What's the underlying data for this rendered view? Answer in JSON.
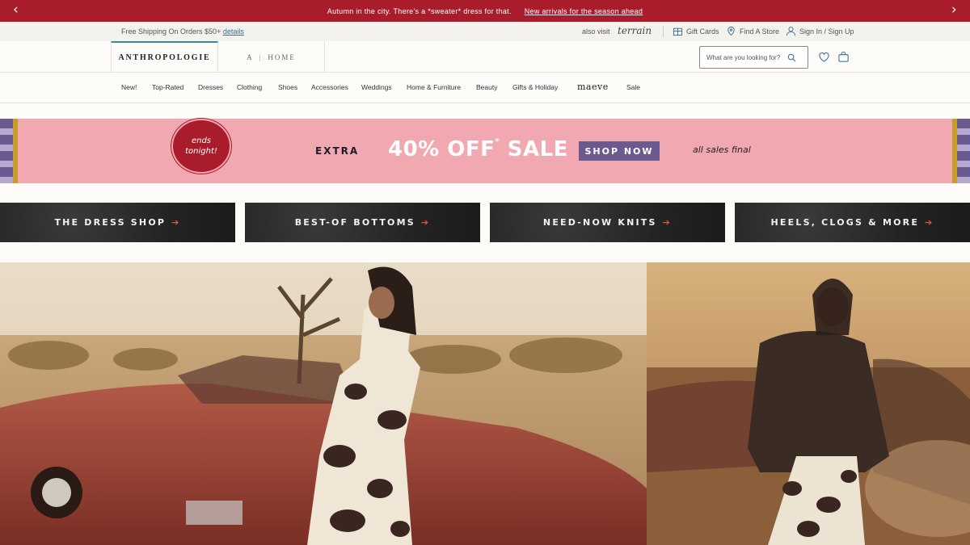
{
  "promo": {
    "message": "Autumn in the city. There's a *sweater* dress for that.",
    "link": "New arrivals for the season ahead",
    "prev_icon": "chevron-left-icon",
    "next_icon": "chevron-right-icon",
    "background": "#a81c2c"
  },
  "utility": {
    "shipping_text": "Free Shipping On Orders $50+",
    "shipping_link": "details",
    "also_visit": "also visit",
    "terrain": "terrain",
    "gift_cards": "Gift Cards",
    "find_store": "Find A Store",
    "sign_in": "Sign In / Sign Up"
  },
  "header": {
    "brand": "ANTHROPOLOGIE",
    "home_a": "A",
    "home_label": "HOME",
    "search_placeholder": "What are you looking for?",
    "accent": "#3b8aa0"
  },
  "nav": {
    "items": [
      "New!",
      "Top-Rated",
      "Dresses",
      "Clothing",
      "Shoes",
      "Accessories",
      "Weddings",
      "Home & Furniture",
      "Beauty",
      "Gifts & Holiday",
      "maeve",
      "Sale"
    ]
  },
  "sale_banner": {
    "ends_line1": "ends",
    "ends_line2": "tonight!",
    "extra": "EXTRA",
    "percent": "40% OFF",
    "asterisk": "*",
    "sale_word": "SALE",
    "cta": "SHOP NOW",
    "note": "all sales final",
    "background": "#f2a8b1"
  },
  "tiles": [
    {
      "label": "THE DRESS SHOP",
      "arrow": "➔"
    },
    {
      "label": "BEST-OF BOTTOMS",
      "arrow": "➔"
    },
    {
      "label": "NEED-NOW KNITS",
      "arrow": "➔"
    },
    {
      "label": "HEELS, CLOGS & MORE",
      "arrow": "➔"
    }
  ]
}
